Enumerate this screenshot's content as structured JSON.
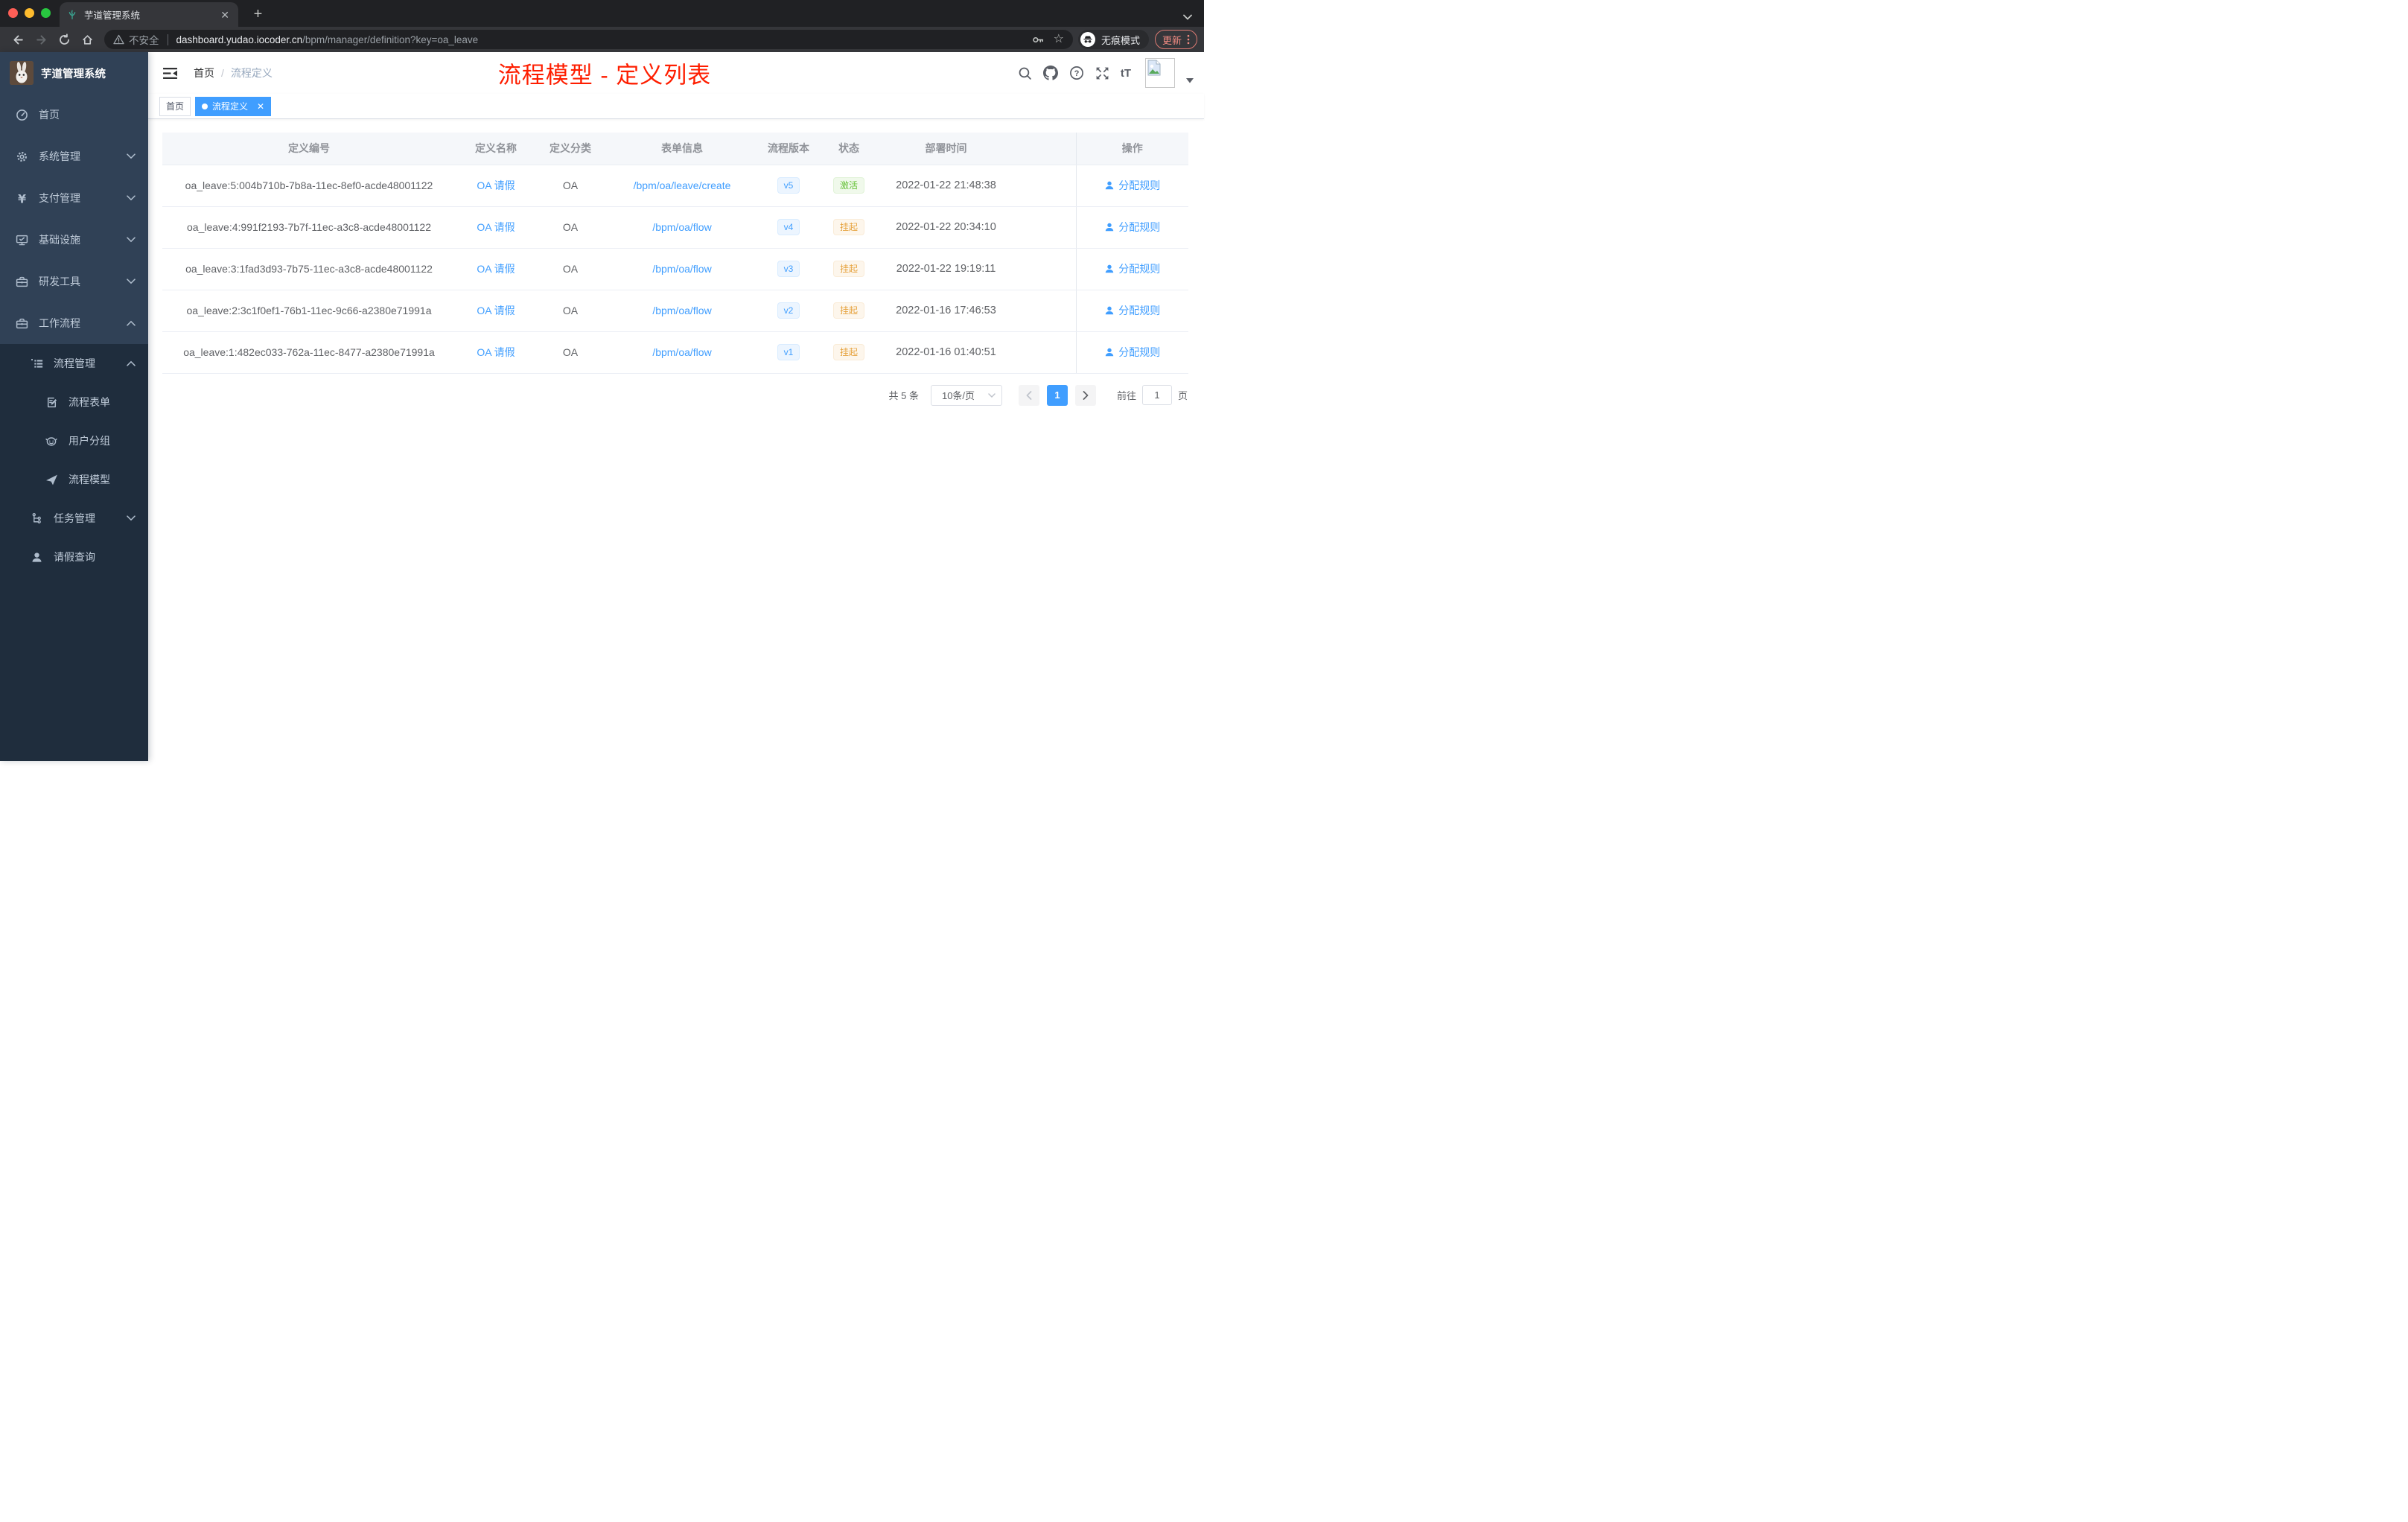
{
  "browser": {
    "tab_title": "芋道管理系统",
    "security_text": "不安全",
    "url_domain": "dashboard.yudao.iocoder.cn",
    "url_path": "/bpm/manager/definition?key=oa_leave",
    "incognito_label": "无痕模式",
    "update_label": "更新"
  },
  "sidebar": {
    "title": "芋道管理系统",
    "items": [
      {
        "key": "home",
        "label": "首页",
        "icon": "dashboard-icon",
        "level": 1,
        "dark": false,
        "expand": ""
      },
      {
        "key": "system",
        "label": "系统管理",
        "icon": "gear-icon",
        "level": 1,
        "dark": false,
        "expand": "down"
      },
      {
        "key": "payment",
        "label": "支付管理",
        "icon": "yen-icon",
        "level": 1,
        "dark": false,
        "expand": "down"
      },
      {
        "key": "infrastructure",
        "label": "基础设施",
        "icon": "monitor-icon",
        "level": 1,
        "dark": false,
        "expand": "down"
      },
      {
        "key": "dev-tools",
        "label": "研发工具",
        "icon": "toolbox-icon",
        "level": 1,
        "dark": false,
        "expand": "down"
      },
      {
        "key": "workflow",
        "label": "工作流程",
        "icon": "briefcase-icon",
        "level": 1,
        "dark": false,
        "expand": "up"
      },
      {
        "key": "process-mgmt",
        "label": "流程管理",
        "icon": "list-tree-icon",
        "level": 2,
        "dark": true,
        "expand": "up"
      },
      {
        "key": "process-form",
        "label": "流程表单",
        "icon": "form-edit-icon",
        "level": 3,
        "dark": true,
        "expand": ""
      },
      {
        "key": "user-group",
        "label": "用户分组",
        "icon": "robot-icon",
        "level": 3,
        "dark": true,
        "expand": ""
      },
      {
        "key": "process-model",
        "label": "流程模型",
        "icon": "paper-plane-icon",
        "level": 3,
        "dark": true,
        "expand": ""
      },
      {
        "key": "task-mgmt",
        "label": "任务管理",
        "icon": "flow-tree-icon",
        "level": 2,
        "dark": true,
        "expand": "down"
      },
      {
        "key": "leave-query",
        "label": "请假查询",
        "icon": "user-icon",
        "level": 2,
        "dark": true,
        "expand": ""
      }
    ]
  },
  "navbar": {
    "breadcrumb_home": "首页",
    "breadcrumb_current": "流程定义",
    "overlay_title": "流程模型 - 定义列表"
  },
  "tags": [
    {
      "label": "首页",
      "active": false
    },
    {
      "label": "流程定义",
      "active": true
    }
  ],
  "table": {
    "columns": [
      {
        "key": "id",
        "label": "定义编号"
      },
      {
        "key": "name",
        "label": "定义名称"
      },
      {
        "key": "category",
        "label": "定义分类"
      },
      {
        "key": "form",
        "label": "表单信息"
      },
      {
        "key": "version",
        "label": "流程版本"
      },
      {
        "key": "status",
        "label": "状态"
      },
      {
        "key": "time",
        "label": "部署时间"
      },
      {
        "key": "ops",
        "label": "操作"
      }
    ],
    "action_label": "分配规则",
    "rows": [
      {
        "id": "oa_leave:5:004b710b-7b8a-11ec-8ef0-acde48001122",
        "name": "OA 请假",
        "category": "OA",
        "form": "/bpm/oa/leave/create",
        "version": "v5",
        "status": {
          "label": "激活",
          "type": "success"
        },
        "deployed_at": "2022-01-22 21:48:38"
      },
      {
        "id": "oa_leave:4:991f2193-7b7f-11ec-a3c8-acde48001122",
        "name": "OA 请假",
        "category": "OA",
        "form": "/bpm/oa/flow",
        "version": "v4",
        "status": {
          "label": "挂起",
          "type": "warning"
        },
        "deployed_at": "2022-01-22 20:34:10"
      },
      {
        "id": "oa_leave:3:1fad3d93-7b75-11ec-a3c8-acde48001122",
        "name": "OA 请假",
        "category": "OA",
        "form": "/bpm/oa/flow",
        "version": "v3",
        "status": {
          "label": "挂起",
          "type": "warning"
        },
        "deployed_at": "2022-01-22 19:19:11"
      },
      {
        "id": "oa_leave:2:3c1f0ef1-76b1-11ec-9c66-a2380e71991a",
        "name": "OA 请假",
        "category": "OA",
        "form": "/bpm/oa/flow",
        "version": "v2",
        "status": {
          "label": "挂起",
          "type": "warning"
        },
        "deployed_at": "2022-01-16 17:46:53"
      },
      {
        "id": "oa_leave:1:482ec033-762a-11ec-8477-a2380e71991a",
        "name": "OA 请假",
        "category": "OA",
        "form": "/bpm/oa/flow",
        "version": "v1",
        "status": {
          "label": "挂起",
          "type": "warning"
        },
        "deployed_at": "2022-01-16 01:40:51"
      }
    ]
  },
  "pagination": {
    "total": "共 5 条",
    "page_size": "10条/页",
    "current": "1",
    "goto_label": "前往",
    "goto_value": "1",
    "page_unit": "页"
  },
  "theme": {
    "accent": "#409eff",
    "success": "#67c23a",
    "warning": "#e6a23c",
    "overlay_title_red": "#fe1e00",
    "sidebar_bg": "#304156",
    "sidebar_submenu_bg": "#1f2d3d",
    "table_header_bg": "#f5f7fa"
  }
}
